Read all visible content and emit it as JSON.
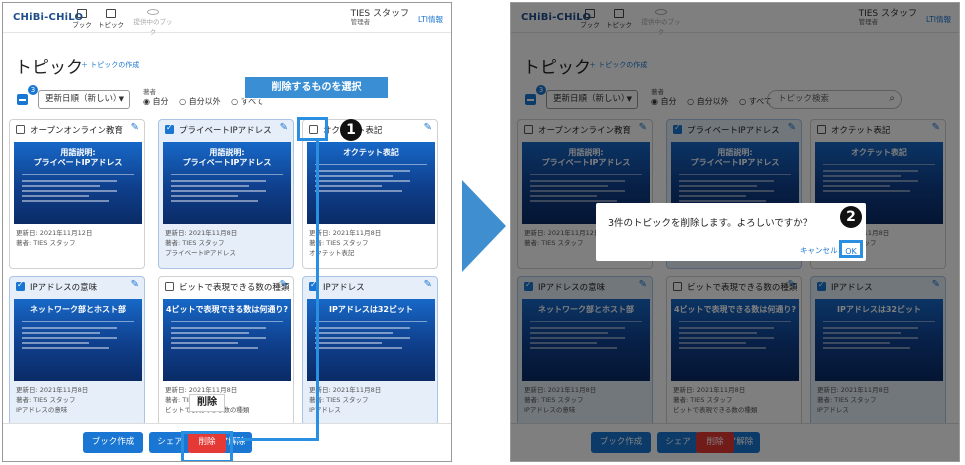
{
  "app": {
    "logo": "CHiBi-CHiLO",
    "nav": [
      {
        "label": "ブック",
        "icon": "book-icon"
      },
      {
        "label": "トピック",
        "icon": "topic-icon"
      },
      {
        "label": "提供中のブック",
        "icon": "link-icon"
      }
    ],
    "user_name": "TIES スタッフ",
    "user_role": "管理者",
    "lti_link": "LTI情報"
  },
  "page": {
    "title": "トピック",
    "create_link": "トピックの作成",
    "selected_count": "3",
    "sort_select": "更新日順（新しい）",
    "author_label": "著者",
    "author_options": [
      "自分",
      "自分以外",
      "すべて"
    ],
    "search_placeholder": "トピック検索"
  },
  "cards": [
    {
      "title": "オープンオンライン教育",
      "checked": false,
      "thumb": "用語説明:\nプライベートIPアドレス",
      "updated": "更新日: 2021年11月12日",
      "author": "著者: TIES スタッフ",
      "sub": ""
    },
    {
      "title": "プライベートIPアドレス",
      "checked": true,
      "thumb": "用語説明:\nプライベートIPアドレス",
      "updated": "更新日: 2021年11月8日",
      "author": "著者: TIES スタッフ",
      "sub": "プライベートIPアドレス"
    },
    {
      "title": "オクテット表記",
      "checked": false,
      "thumb": "オクテット表記",
      "updated": "更新日: 2021年11月8日",
      "author": "著者: TIES スタッフ",
      "sub": "オクテット表記"
    },
    {
      "title": "IPアドレスの意味",
      "checked": true,
      "thumb": "ネットワーク部とホスト部",
      "updated": "更新日: 2021年11月8日",
      "author": "著者: TIES スタッフ",
      "sub": "IPアドレスの意味"
    },
    {
      "title": "ビットで表現できる数の種類",
      "checked": false,
      "thumb": "4ビットで表現できる数は何通り?",
      "updated": "更新日: 2021年11月8日",
      "author": "著者: TIES スタッフ",
      "sub": "ビットで表現できる数の種類"
    },
    {
      "title": "IPアドレス",
      "checked": true,
      "thumb": "IPアドレスは32ビット",
      "updated": "更新日: 2021年11月8日",
      "author": "著者: TIES スタッフ",
      "sub": "IPアドレス"
    }
  ],
  "footer": {
    "buttons": [
      {
        "label": "ブック作成"
      },
      {
        "label": "シェア"
      },
      {
        "label": "シェア解除"
      },
      {
        "label": "削除"
      }
    ]
  },
  "annotations": {
    "select_callout": "削除するものを選択",
    "delete_callout": "削除",
    "step1": "1",
    "step2": "2"
  },
  "dialog": {
    "message": "3件のトピックを削除します。よろしいですか？",
    "cancel": "キャンセル",
    "ok": "OK"
  },
  "colors": {
    "accent": "#1976d2",
    "danger": "#e53935",
    "callout": "#3a8fd4"
  }
}
